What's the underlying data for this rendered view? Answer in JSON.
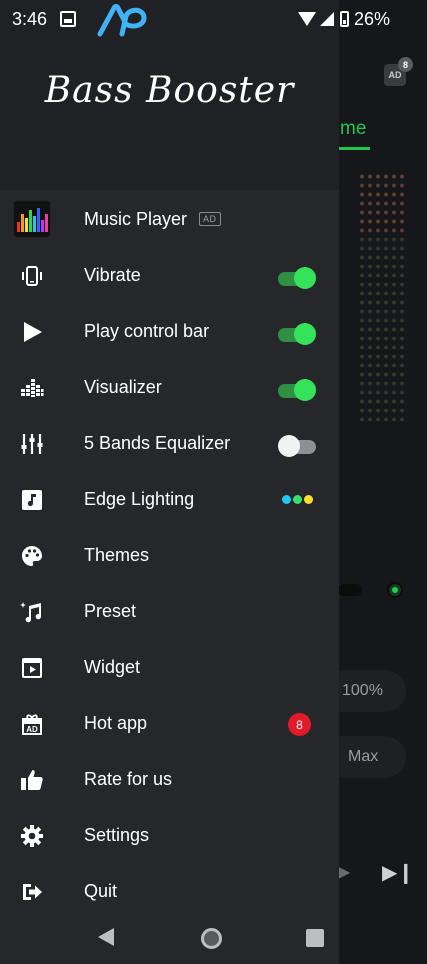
{
  "status_bar": {
    "time": "3:46",
    "battery": "26%"
  },
  "background_app": {
    "tab_label": "me",
    "ad_badge_count": "8",
    "ad_badge_text": "AD",
    "volume_pill": "100%",
    "max_pill": "Max"
  },
  "drawer": {
    "brand": "Bass Booster",
    "ad_tag": "AD",
    "items": [
      {
        "label": "Music Player",
        "icon": "music-player-app-icon",
        "trailing": "ad-tag"
      },
      {
        "label": "Vibrate",
        "icon": "phone-vibrate-icon",
        "trailing": "toggle",
        "toggle_on": true
      },
      {
        "label": "Play control bar",
        "icon": "play-icon",
        "trailing": "toggle",
        "toggle_on": true
      },
      {
        "label": "Visualizer",
        "icon": "equalizer-bars-icon",
        "trailing": "toggle",
        "toggle_on": true
      },
      {
        "label": "5 Bands Equalizer",
        "icon": "sliders-icon",
        "trailing": "toggle",
        "toggle_on": false
      },
      {
        "label": "Edge Lighting",
        "icon": "music-note-icon",
        "trailing": "color-dots",
        "dot_colors": [
          "#1ec8f2",
          "#39e06b",
          "#f6e22f"
        ]
      },
      {
        "label": "Themes",
        "icon": "palette-icon"
      },
      {
        "label": "Preset",
        "icon": "music-sparkle-icon"
      },
      {
        "label": "Widget",
        "icon": "widget-icon"
      },
      {
        "label": "Hot app",
        "icon": "gift-ad-icon",
        "trailing": "badge",
        "badge": "8"
      },
      {
        "label": "Rate for us",
        "icon": "thumbs-up-icon"
      },
      {
        "label": "Settings",
        "icon": "gear-icon"
      },
      {
        "label": "Quit",
        "icon": "exit-icon"
      }
    ]
  },
  "colors": {
    "accent_green": "#35e35b",
    "badge_red": "#e21a2a",
    "drawer_bg": "#25272b"
  }
}
